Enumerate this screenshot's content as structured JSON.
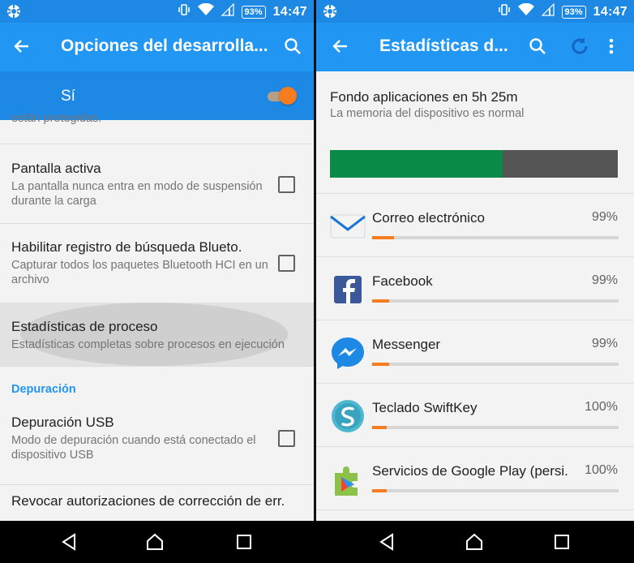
{
  "status_bar": {
    "time": "14:47",
    "battery": "93%"
  },
  "left_screen": {
    "title": "Opciones del desarrolla...",
    "toggle": {
      "label": "Sí",
      "state": "on"
    },
    "partial_text": "están protegidas.",
    "items": [
      {
        "title": "Pantalla activa",
        "desc": "La pantalla nunca entra en modo de suspensión durante la carga",
        "checked": false
      },
      {
        "title": "Habilitar registro de búsqueda Blueto.",
        "desc": "Capturar todos los paquetes Bluetooth HCI en un archivo",
        "checked": false
      },
      {
        "title": "Estadísticas de proceso",
        "desc": "Estadísticas completas sobre procesos en ejecución"
      }
    ],
    "section": "Depuración",
    "usb": {
      "title": "Depuración USB",
      "desc": "Modo de depuración cuando está conectado el dispositivo USB",
      "checked": false
    },
    "revoke": "Revocar autorizaciones de corrección de err."
  },
  "right_screen": {
    "title": "Estadísticas d...",
    "summary_title": "Fondo aplicaciones en 5h 25m",
    "summary_sub": "La memoria del dispositivo es normal",
    "memory_used_fraction": 0.6,
    "apps": [
      {
        "name": "Correo electrónico",
        "percent": "99%",
        "usage_fraction": 0.09,
        "icon": "email-icon"
      },
      {
        "name": "Facebook",
        "percent": "99%",
        "usage_fraction": 0.07,
        "icon": "facebook-icon"
      },
      {
        "name": "Messenger",
        "percent": "99%",
        "usage_fraction": 0.07,
        "icon": "messenger-icon"
      },
      {
        "name": "Teclado SwiftKey",
        "percent": "100%",
        "usage_fraction": 0.06,
        "icon": "swiftkey-icon"
      },
      {
        "name": "Servicios de Google Play (persi.",
        "percent": "100%",
        "usage_fraction": 0.06,
        "icon": "google-play-services-icon"
      }
    ]
  },
  "colors": {
    "status_bar": "#1e88e5",
    "app_bar": "#2196f3",
    "accent": "#f57c1f",
    "memory_fill": "#0a8a47",
    "memory_free": "#555555"
  }
}
